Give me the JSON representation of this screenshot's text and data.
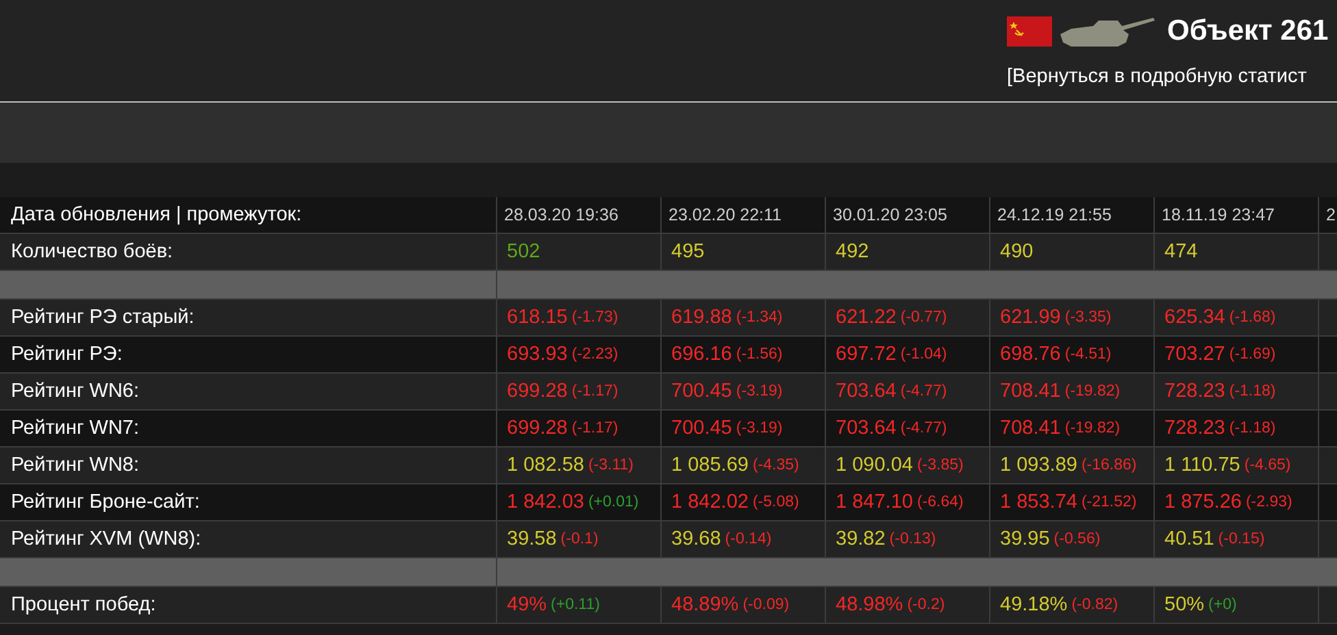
{
  "header": {
    "title": "Объект 261",
    "back_link": "[Вернуться в подробную статист"
  },
  "table": {
    "columns": [
      "28.03.20 19:36",
      "23.02.20 22:11",
      "30.01.20 23:05",
      "24.12.19 21:55",
      "18.11.19 23:47",
      "2"
    ],
    "header_label": "Дата обновления | промежуток:",
    "rows": [
      {
        "kind": "data",
        "label": "Количество боёв:",
        "cells": [
          {
            "value": "502",
            "color": "#5ea91a"
          },
          {
            "value": "495",
            "color": "#d4cb2e"
          },
          {
            "value": "492",
            "color": "#d4cb2e"
          },
          {
            "value": "490",
            "color": "#d4cb2e"
          },
          {
            "value": "474",
            "color": "#d4cb2e"
          }
        ]
      },
      {
        "kind": "separator"
      },
      {
        "kind": "data",
        "label": "Рейтинг РЭ старый:",
        "cells": [
          {
            "value": "618.15",
            "color": "#f52626",
            "delta": {
              "text": "(-1.73)",
              "color": "#f52626"
            }
          },
          {
            "value": "619.88",
            "color": "#f52626",
            "delta": {
              "text": "(-1.34)",
              "color": "#f52626"
            }
          },
          {
            "value": "621.22",
            "color": "#f52626",
            "delta": {
              "text": "(-0.77)",
              "color": "#f52626"
            }
          },
          {
            "value": "621.99",
            "color": "#f52626",
            "delta": {
              "text": "(-3.35)",
              "color": "#f52626"
            }
          },
          {
            "value": "625.34",
            "color": "#f52626",
            "delta": {
              "text": "(-1.68)",
              "color": "#f52626"
            }
          }
        ]
      },
      {
        "kind": "data",
        "label": "Рейтинг РЭ:",
        "cells": [
          {
            "value": "693.93",
            "color": "#f52626",
            "delta": {
              "text": "(-2.23)",
              "color": "#f52626"
            }
          },
          {
            "value": "696.16",
            "color": "#f52626",
            "delta": {
              "text": "(-1.56)",
              "color": "#f52626"
            }
          },
          {
            "value": "697.72",
            "color": "#f52626",
            "delta": {
              "text": "(-1.04)",
              "color": "#f52626"
            }
          },
          {
            "value": "698.76",
            "color": "#f52626",
            "delta": {
              "text": "(-4.51)",
              "color": "#f52626"
            }
          },
          {
            "value": "703.27",
            "color": "#f52626",
            "delta": {
              "text": "(-1.69)",
              "color": "#f52626"
            }
          }
        ]
      },
      {
        "kind": "data",
        "label": "Рейтинг WN6:",
        "cells": [
          {
            "value": "699.28",
            "color": "#f52626",
            "delta": {
              "text": "(-1.17)",
              "color": "#f52626"
            }
          },
          {
            "value": "700.45",
            "color": "#f52626",
            "delta": {
              "text": "(-3.19)",
              "color": "#f52626"
            }
          },
          {
            "value": "703.64",
            "color": "#f52626",
            "delta": {
              "text": "(-4.77)",
              "color": "#f52626"
            }
          },
          {
            "value": "708.41",
            "color": "#f52626",
            "delta": {
              "text": "(-19.82)",
              "color": "#f52626"
            }
          },
          {
            "value": "728.23",
            "color": "#f52626",
            "delta": {
              "text": "(-1.18)",
              "color": "#f52626"
            }
          }
        ]
      },
      {
        "kind": "data",
        "label": "Рейтинг WN7:",
        "cells": [
          {
            "value": "699.28",
            "color": "#f52626",
            "delta": {
              "text": "(-1.17)",
              "color": "#f52626"
            }
          },
          {
            "value": "700.45",
            "color": "#f52626",
            "delta": {
              "text": "(-3.19)",
              "color": "#f52626"
            }
          },
          {
            "value": "703.64",
            "color": "#f52626",
            "delta": {
              "text": "(-4.77)",
              "color": "#f52626"
            }
          },
          {
            "value": "708.41",
            "color": "#f52626",
            "delta": {
              "text": "(-19.82)",
              "color": "#f52626"
            }
          },
          {
            "value": "728.23",
            "color": "#f52626",
            "delta": {
              "text": "(-1.18)",
              "color": "#f52626"
            }
          }
        ]
      },
      {
        "kind": "data",
        "label": "Рейтинг WN8:",
        "cells": [
          {
            "value": "1 082.58",
            "color": "#d4cb2e",
            "delta": {
              "text": "(-3.11)",
              "color": "#f52626"
            }
          },
          {
            "value": "1 085.69",
            "color": "#d4cb2e",
            "delta": {
              "text": "(-4.35)",
              "color": "#f52626"
            }
          },
          {
            "value": "1 090.04",
            "color": "#d4cb2e",
            "delta": {
              "text": "(-3.85)",
              "color": "#f52626"
            }
          },
          {
            "value": "1 093.89",
            "color": "#d4cb2e",
            "delta": {
              "text": "(-16.86)",
              "color": "#f52626"
            }
          },
          {
            "value": "1 110.75",
            "color": "#d4cb2e",
            "delta": {
              "text": "(-4.65)",
              "color": "#f52626"
            }
          }
        ]
      },
      {
        "kind": "data",
        "label": "Рейтинг Броне-сайт:",
        "cells": [
          {
            "value": "1 842.03",
            "color": "#f52626",
            "delta": {
              "text": "(+0.01)",
              "color": "#2e9e2e"
            }
          },
          {
            "value": "1 842.02",
            "color": "#f52626",
            "delta": {
              "text": "(-5.08)",
              "color": "#f52626"
            }
          },
          {
            "value": "1 847.10",
            "color": "#f52626",
            "delta": {
              "text": "(-6.64)",
              "color": "#f52626"
            }
          },
          {
            "value": "1 853.74",
            "color": "#f52626",
            "delta": {
              "text": "(-21.52)",
              "color": "#f52626"
            }
          },
          {
            "value": "1 875.26",
            "color": "#f52626",
            "delta": {
              "text": "(-2.93)",
              "color": "#f52626"
            }
          }
        ]
      },
      {
        "kind": "data",
        "label": "Рейтинг XVM (WN8):",
        "cells": [
          {
            "value": "39.58",
            "color": "#d4cb2e",
            "delta": {
              "text": "(-0.1)",
              "color": "#f52626"
            }
          },
          {
            "value": "39.68",
            "color": "#d4cb2e",
            "delta": {
              "text": "(-0.14)",
              "color": "#f52626"
            }
          },
          {
            "value": "39.82",
            "color": "#d4cb2e",
            "delta": {
              "text": "(-0.13)",
              "color": "#f52626"
            }
          },
          {
            "value": "39.95",
            "color": "#d4cb2e",
            "delta": {
              "text": "(-0.56)",
              "color": "#f52626"
            }
          },
          {
            "value": "40.51",
            "color": "#d4cb2e",
            "delta": {
              "text": "(-0.15)",
              "color": "#f52626"
            }
          }
        ]
      },
      {
        "kind": "separator"
      },
      {
        "kind": "data",
        "label": "Процент побед:",
        "cells": [
          {
            "value": "49%",
            "color": "#f52626",
            "delta": {
              "text": "(+0.11)",
              "color": "#2e9e2e"
            }
          },
          {
            "value": "48.89%",
            "color": "#f52626",
            "delta": {
              "text": "(-0.09)",
              "color": "#f52626"
            }
          },
          {
            "value": "48.98%",
            "color": "#f52626",
            "delta": {
              "text": "(-0.2)",
              "color": "#f52626"
            }
          },
          {
            "value": "49.18%",
            "color": "#d4cb2e",
            "delta": {
              "text": "(-0.82)",
              "color": "#f52626"
            }
          },
          {
            "value": "50%",
            "color": "#d4cb2e",
            "delta": {
              "text": "(+0)",
              "color": "#2e9e2e"
            }
          }
        ]
      }
    ]
  }
}
